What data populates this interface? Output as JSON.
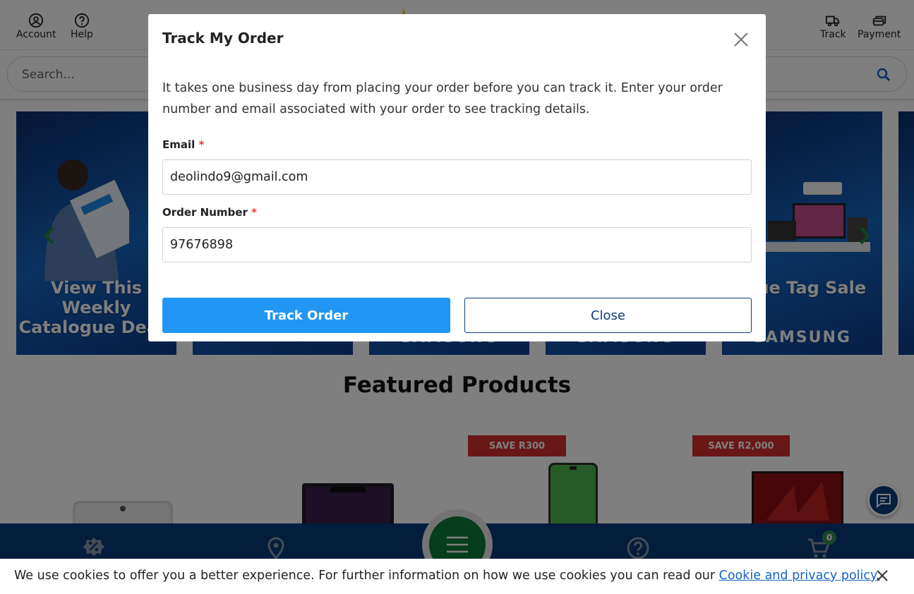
{
  "header": {
    "account_label": "Account",
    "help_label": "Help",
    "track_label": "Track",
    "payment_label": "Payment"
  },
  "search": {
    "placeholder": "Search..."
  },
  "banners": {
    "b1_text": "View This Weekly Catalogue Deals",
    "b5_text": "Blue Tag Sale",
    "brand": "SAMSUNG"
  },
  "featured": {
    "title": "Featured Products",
    "badges": [
      "SAVE R300",
      "SAVE R2,000"
    ]
  },
  "bottom_nav": {
    "cart_count": "0"
  },
  "cookie": {
    "text": "We use cookies to offer you a better experience. For further information on how we use cookies you can read our ",
    "link": "Cookie and privacy policy."
  },
  "modal": {
    "title": "Track My Order",
    "description": "It takes one business day from placing your order before you can track it. Enter your order number and email associated with your order to see tracking details.",
    "email_label": "Email",
    "email_value": "deolindo9@gmail.com",
    "order_label": "Order Number",
    "order_value": "97676898",
    "required_mark": "*",
    "track_button": "Track Order",
    "close_button": "Close"
  },
  "colors": {
    "primary_blue": "#2196f3",
    "navy": "#0b3d7d",
    "bottom_nav": "#083b7a",
    "save_red": "#d32f2f",
    "menu_green": "#0c7a3a"
  }
}
